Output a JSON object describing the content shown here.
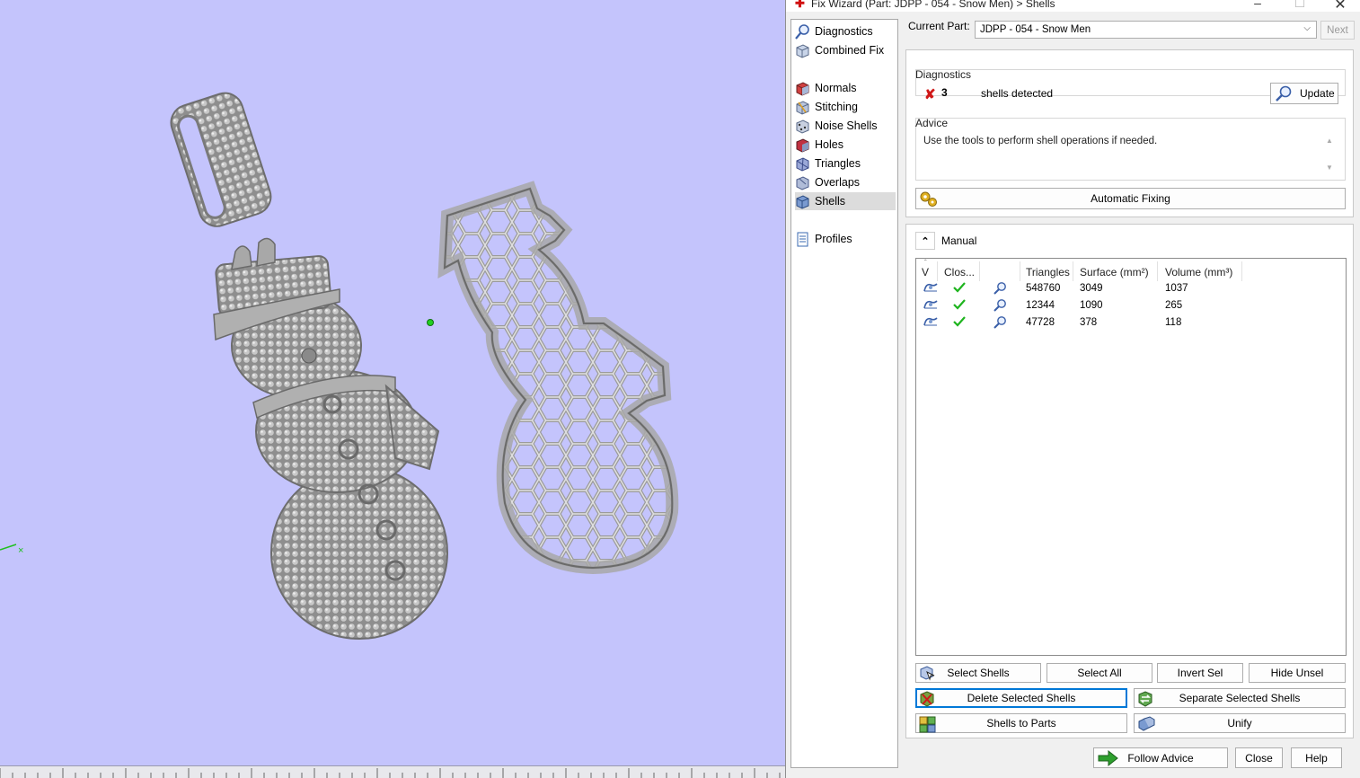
{
  "window": {
    "title": "Fix Wizard (Part: JDPP - 054 - Snow Men) > Shells",
    "minimize_glyph": "–",
    "maximize_glyph": "☐",
    "close_glyph": "✕"
  },
  "nav": {
    "items": [
      {
        "label": "Diagnostics",
        "icon": "magnifier-icon"
      },
      {
        "label": "Combined Fix",
        "icon": "cube-icon"
      },
      {
        "label": "Normals",
        "icon": "normals-cube-icon"
      },
      {
        "label": "Stitching",
        "icon": "stitching-cube-icon"
      },
      {
        "label": "Noise Shells",
        "icon": "noise-shells-icon"
      },
      {
        "label": "Holes",
        "icon": "holes-cube-icon"
      },
      {
        "label": "Triangles",
        "icon": "triangles-cube-icon"
      },
      {
        "label": "Overlaps",
        "icon": "overlaps-cube-icon"
      },
      {
        "label": "Shells",
        "icon": "shells-cube-icon"
      },
      {
        "label": "Profiles",
        "icon": "profiles-doc-icon"
      }
    ],
    "active": "Shells"
  },
  "current_part": {
    "label": "Current Part:",
    "value": "JDPP - 054 - Snow Men",
    "next_label": "Next"
  },
  "diagnostics": {
    "label": "Diagnostics",
    "count": "3",
    "text": "shells detected",
    "update_label": "Update",
    "status_color": "#d01818"
  },
  "advice": {
    "label": "Advice",
    "text": "Use the tools to perform shell operations if needed."
  },
  "automatic_fixing_label": "Automatic Fixing",
  "manual": {
    "label": "Manual",
    "toggle_glyph": "⌃"
  },
  "shells_table": {
    "columns": [
      "V",
      "Clos...",
      "",
      "Triangles",
      "Surface (mm²)",
      "Volume (mm³)"
    ],
    "rows": [
      {
        "triangles": "548760",
        "surface": "3049",
        "volume": "1037",
        "closed": true
      },
      {
        "triangles": "12344",
        "surface": "1090",
        "volume": "265",
        "closed": true
      },
      {
        "triangles": "47728",
        "surface": "378",
        "volume": "118",
        "closed": true
      }
    ]
  },
  "buttons": {
    "select_shells": "Select Shells",
    "select_all": "Select All",
    "invert_sel": "Invert Sel",
    "hide_unsel": "Hide Unsel",
    "delete_selected_shells": "Delete Selected Shells",
    "separate_selected_shells": "Separate Selected Shells",
    "shells_to_parts": "Shells to Parts",
    "unify": "Unify",
    "follow_advice": "Follow Advice",
    "close": "Close",
    "help": "Help"
  },
  "colors": {
    "viewport_bg": "#c4c4fc",
    "accent_focus": "#0078d7",
    "check_green": "#1eb41e"
  }
}
